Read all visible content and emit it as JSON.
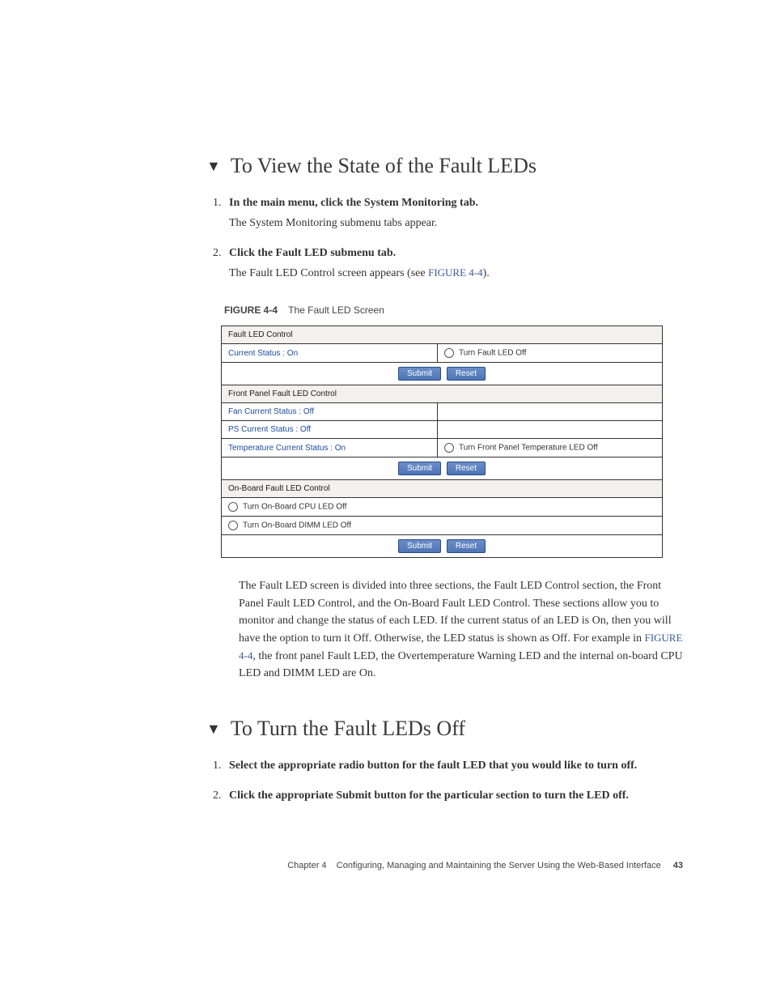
{
  "section1": {
    "title": "To View the State of the Fault LEDs",
    "steps": [
      {
        "title": "In the main menu, click the System Monitoring tab.",
        "body": "The System Monitoring submenu tabs appear."
      },
      {
        "title": "Click the Fault LED submenu tab.",
        "body_pre": "The Fault LED Control screen appears (see ",
        "body_ref": "FIGURE 4-4",
        "body_post": ")."
      }
    ]
  },
  "figure": {
    "label": "FIGURE 4-4",
    "caption": "The Fault LED Screen",
    "blocks": {
      "b1": {
        "header": "Fault LED Control",
        "row1_left": "Current Status : On",
        "row1_right": "Turn Fault LED Off",
        "submit": "Submit",
        "reset": "Reset"
      },
      "b2": {
        "header": "Front Panel Fault LED Control",
        "r1": "Fan Current Status : Off",
        "r2": "PS Current Status : Off",
        "r3_left": "Temperature Current Status : On",
        "r3_right": "Turn Front Panel Temperature LED Off",
        "submit": "Submit",
        "reset": "Reset"
      },
      "b3": {
        "header": "On-Board Fault LED Control",
        "r1": "Turn On-Board CPU LED Off",
        "r2": "Turn On-Board DIMM LED Off",
        "submit": "Submit",
        "reset": "Reset"
      }
    }
  },
  "para_pre": "The Fault LED screen is divided into three sections, the Fault LED Control section, the Front Panel Fault LED Control, and the On-Board Fault LED Control. These sections allow you to monitor and change the status of each LED. If the current status of an LED is On, then you will have the option to turn it Off. Otherwise, the LED status is shown as Off. For example in ",
  "para_ref": "FIGURE 4-4",
  "para_post": ", the front panel Fault LED, the Overtemperature Warning LED and the internal on-board CPU LED and DIMM LED are On.",
  "section2": {
    "title": "To Turn the Fault LEDs Off",
    "steps": [
      {
        "title": "Select the appropriate radio button for the fault LED that you would like to turn off."
      },
      {
        "title": "Click the appropriate Submit button for the particular section to turn the LED off."
      }
    ]
  },
  "footer": {
    "chapter": "Chapter 4",
    "title": "Configuring, Managing and Maintaining the Server Using the Web-Based Interface",
    "page": "43"
  }
}
